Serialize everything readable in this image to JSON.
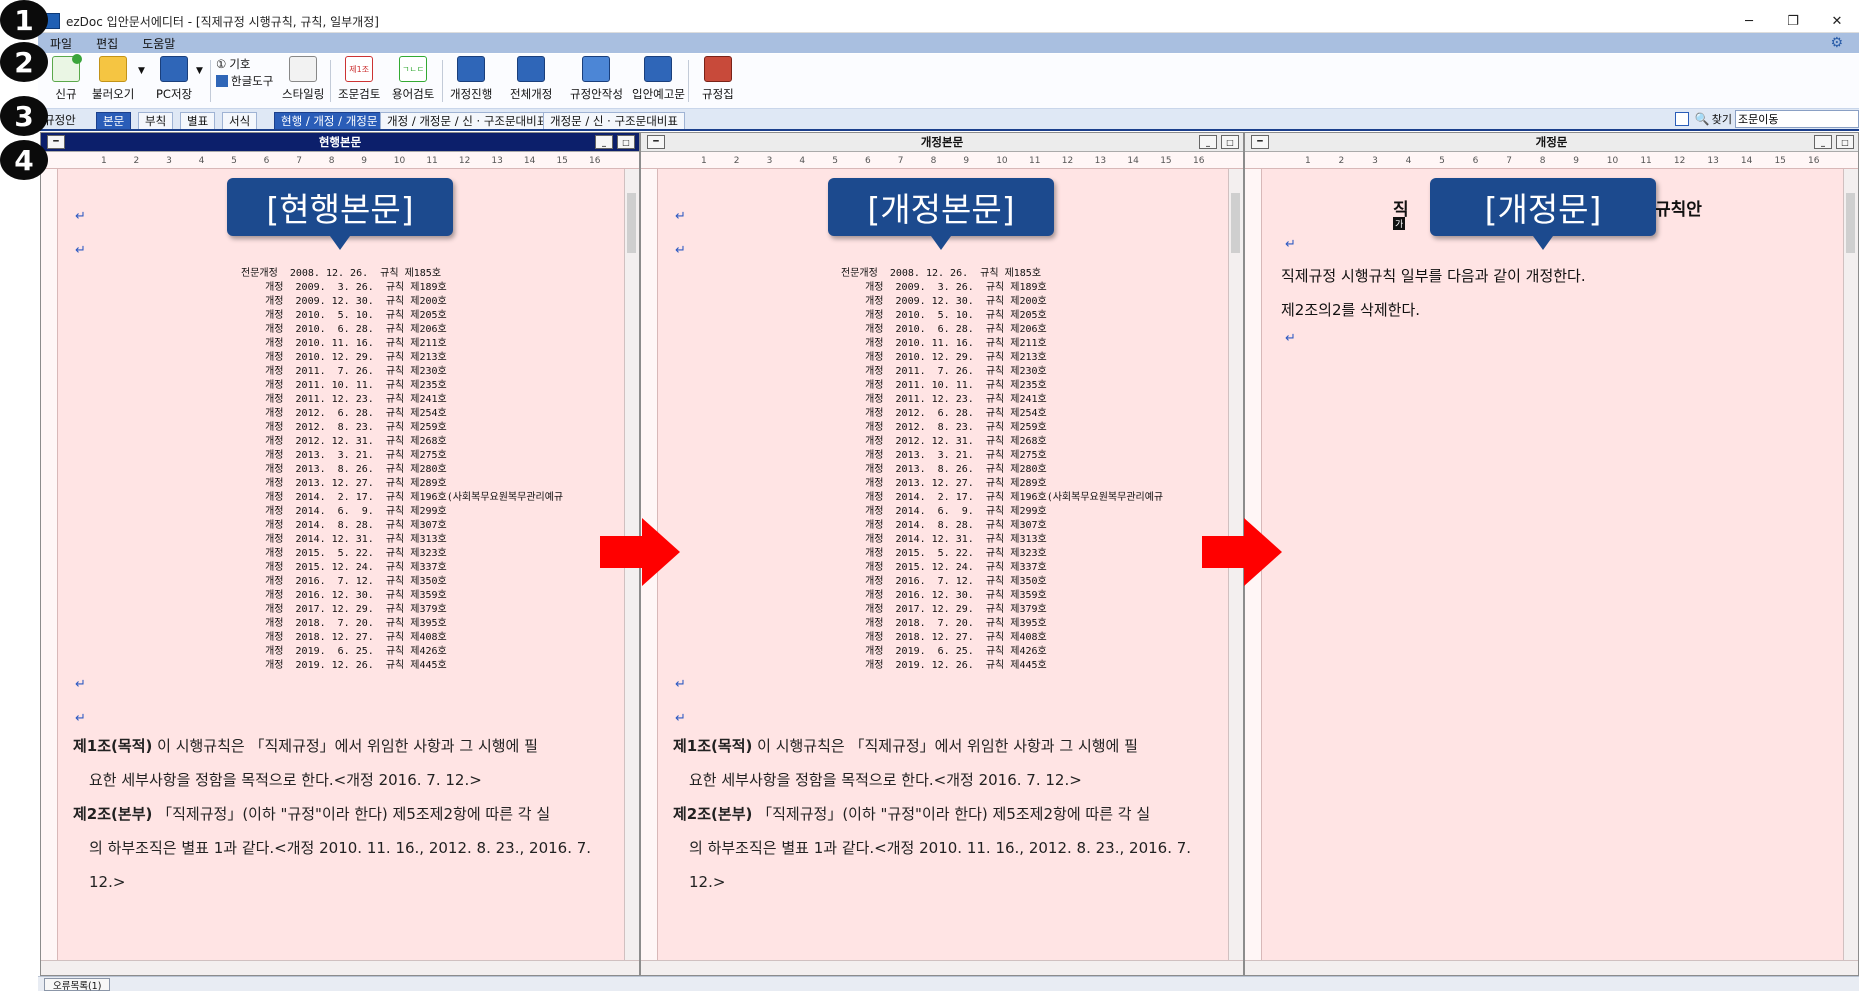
{
  "app": {
    "title": "ezDoc 입안문서에디터 - [직제규정 시행규칙, 규칙, 일부개정]",
    "minimize": "─",
    "restore": "❐",
    "close": "✕"
  },
  "steps": [
    "1",
    "2",
    "3",
    "4"
  ],
  "menu": [
    "파일",
    "편집",
    "도움말"
  ],
  "toolbar": {
    "new": "신규",
    "open": "불러오기",
    "pc_save": "PC저장",
    "symbol": "기호",
    "hangul_tool": "한글도구",
    "styling": "스타일링",
    "article_check": "조문검토",
    "term_check": "용어검토",
    "revise_progress": "개정진행",
    "full_revise": "전체개정",
    "draft_write": "규정안작성",
    "notice": "입안예고문",
    "regulation_book": "규정집",
    "symbol_icon": "①",
    "article_icon_text": "제1조",
    "term_icon_text": "ㄱㄴㄷ"
  },
  "tabs": {
    "draft": "규정안",
    "body": "본문",
    "annex": "부칙",
    "table": "별표",
    "form": "서식",
    "view1": "현행 / 개정 / 개정문",
    "view2": "개정 / 개정문 / 신 · 구조문대비표",
    "view3": "개정문 / 신 · 구조문대비표"
  },
  "find": {
    "label": "찾기",
    "value": "조문이동"
  },
  "panes": {
    "current": {
      "title": "현행본문",
      "callout": "[현행본문]"
    },
    "revised": {
      "title": "개정본문",
      "callout": "[개정본문]"
    },
    "amend": {
      "title": "개정문",
      "callout": "[개정문]",
      "heading_left": "직",
      "heading_right": "규칙안",
      "heading_mark": "가",
      "line1": "직제규정 시행규칙 일부를 다음과 같이 개정한다.",
      "line2": "제2조의2를 삭제한다."
    }
  },
  "history": [
    "전문개정  2008. 12. 26.  규칙 제185호",
    "    개정  2009.  3. 26.  규칙 제189호",
    "    개정  2009. 12. 30.  규칙 제200호",
    "    개정  2010.  5. 10.  규칙 제205호",
    "    개정  2010.  6. 28.  규칙 제206호",
    "    개정  2010. 11. 16.  규칙 제211호",
    "    개정  2010. 12. 29.  규칙 제213호",
    "    개정  2011.  7. 26.  규칙 제230호",
    "    개정  2011. 10. 11.  규칙 제235호",
    "    개정  2011. 12. 23.  규칙 제241호",
    "    개정  2012.  6. 28.  규칙 제254호",
    "    개정  2012.  8. 23.  규칙 제259호",
    "    개정  2012. 12. 31.  규칙 제268호",
    "    개정  2013.  3. 21.  규칙 제275호",
    "    개정  2013.  8. 26.  규칙 제280호",
    "    개정  2013. 12. 27.  규칙 제289호",
    "    개정  2014.  2. 17.  규칙 제196호(사회복무요원복무관리예규",
    "    개정  2014.  6.  9.  규칙 제299호",
    "    개정  2014.  8. 28.  규칙 제307호",
    "    개정  2014. 12. 31.  규칙 제313호",
    "    개정  2015.  5. 22.  규칙 제323호",
    "    개정  2015. 12. 24.  규칙 제337호",
    "    개정  2016.  7. 12.  규칙 제350호",
    "    개정  2016. 12. 30.  규칙 제359호",
    "    개정  2017. 12. 29.  규칙 제379호",
    "    개정  2018.  7. 20.  규칙 제395호",
    "    개정  2018. 12. 27.  규칙 제408호",
    "    개정  2019.  6. 25.  규칙 제426호",
    "    개정  2019. 12. 26.  규칙 제445호"
  ],
  "articles": {
    "a1_title": "제1조(목적)",
    "a1_text1": " 이 시행규칙은 「직제규정」에서 위임한 사항과 그 시행에 필",
    "a1_text2": "요한 세부사항을 정함을 목적으로 한다.<개정 2016. 7. 12.>",
    "a2_title": "제2조(본부)",
    "a2_text1": " 「직제규정」(이하 \"규정\"이라 한다) 제5조제2항에 따른 각 실",
    "a2_text2": "의 하부조직은 별표 1과 같다.<개정 2010. 11. 16., 2012. 8. 23., 2016. 7.",
    "a2_text3": "12.>"
  },
  "status": {
    "error_list": "오류목록(1)"
  },
  "colors": {
    "pane_bg": "#ffe4e4",
    "callout": "#1c4a8e",
    "arrow": "#ff0000",
    "menubar": "#a9bfe0",
    "active_tab": "#2a5db8"
  }
}
